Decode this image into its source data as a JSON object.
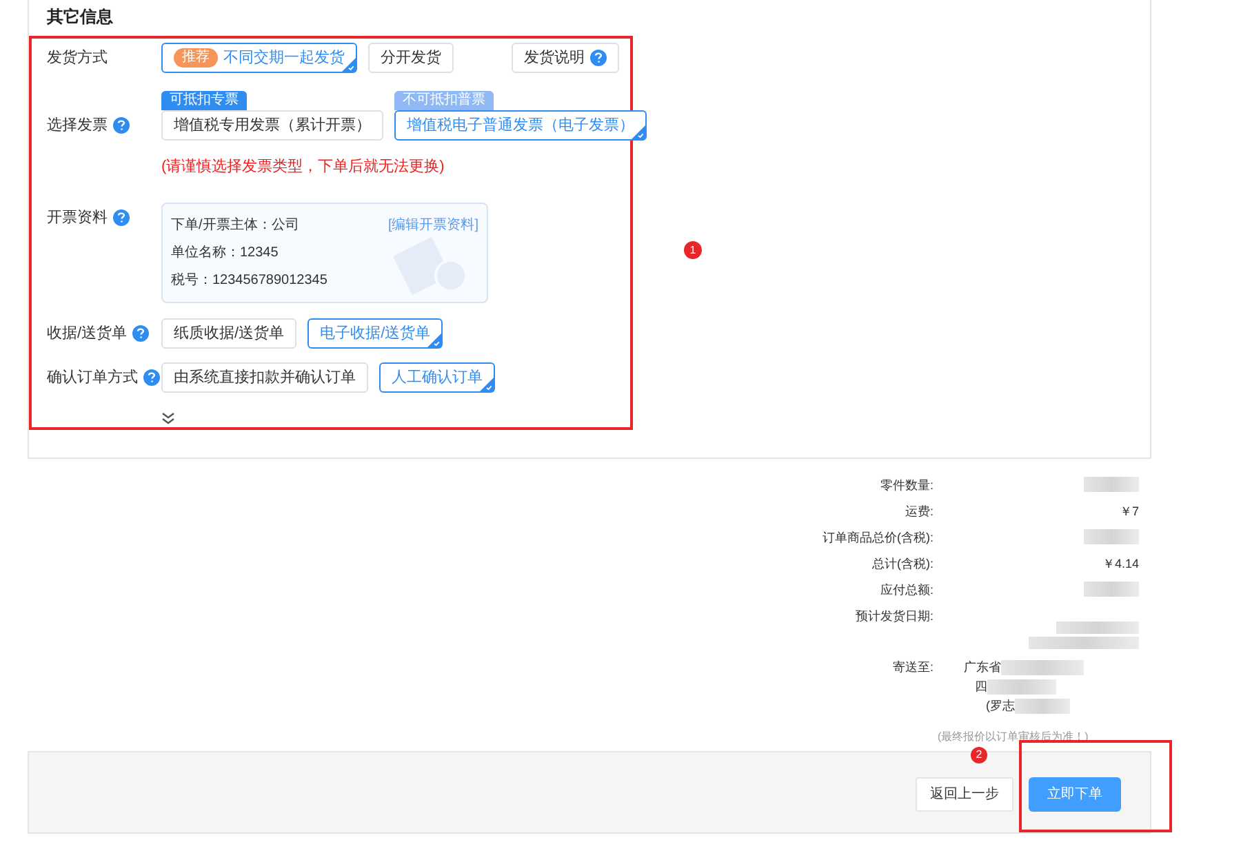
{
  "section_title": "其它信息",
  "form_rows": [
    {
      "kind": "options",
      "label": "发货方式",
      "help": false,
      "options": [
        {
          "badge": "推荐",
          "label": "不同交期一起发货",
          "selected": true
        },
        {
          "label": "分开发货",
          "selected": false
        }
      ],
      "extra_button": {
        "label": "发货说明",
        "help": true
      }
    },
    {
      "kind": "invoice",
      "label": "选择发票",
      "help": true,
      "options": [
        {
          "tag": "可抵扣专票",
          "label": "增值税专用发票（累计开票）",
          "selected": false
        },
        {
          "tag": "不可抵扣普票",
          "label": "增值税电子普通发票（电子发票）",
          "selected": true
        }
      ],
      "warning": "(请谨慎选择发票类型，下单后就无法更换)"
    },
    {
      "kind": "card",
      "label": "开票资料",
      "help": true,
      "lines": [
        "下单/开票主体：公司",
        "单位名称：12345",
        "税号：123456789012345"
      ],
      "link": "[编辑开票资料]"
    },
    {
      "kind": "options",
      "label": "收据/送货单",
      "help": true,
      "options": [
        {
          "label": "纸质收据/送货单",
          "selected": false
        },
        {
          "label": "电子收据/送货单",
          "selected": true
        }
      ]
    },
    {
      "kind": "options",
      "label": "确认订单方式",
      "help": true,
      "options": [
        {
          "label": "由系统直接扣款并确认订单",
          "selected": false
        },
        {
          "label": "人工确认订单",
          "selected": true
        }
      ]
    }
  ],
  "expand": {
    "expanded": false
  },
  "annotations": [
    "1",
    "2"
  ],
  "summary": [
    {
      "label": "零件数量:",
      "redacted": true
    },
    {
      "label": "运费:",
      "value": "￥7",
      "redacted": false
    },
    {
      "label": "订单商品总价(含税):",
      "redacted": true
    },
    {
      "label": "总计(含税):",
      "value": "￥4.14",
      "redacted": false
    },
    {
      "label": "应付总额:",
      "redacted": true
    },
    {
      "label": "预计发货日期:",
      "redacted": true
    },
    {
      "label": "寄送至:",
      "address": [
        "广东省",
        "四",
        "(罗志"
      ],
      "redacted": true
    }
  ],
  "note": "(最终报价以订单审核后为准！)",
  "buttons": {
    "back": "返回上一步",
    "submit": "立即下单"
  }
}
